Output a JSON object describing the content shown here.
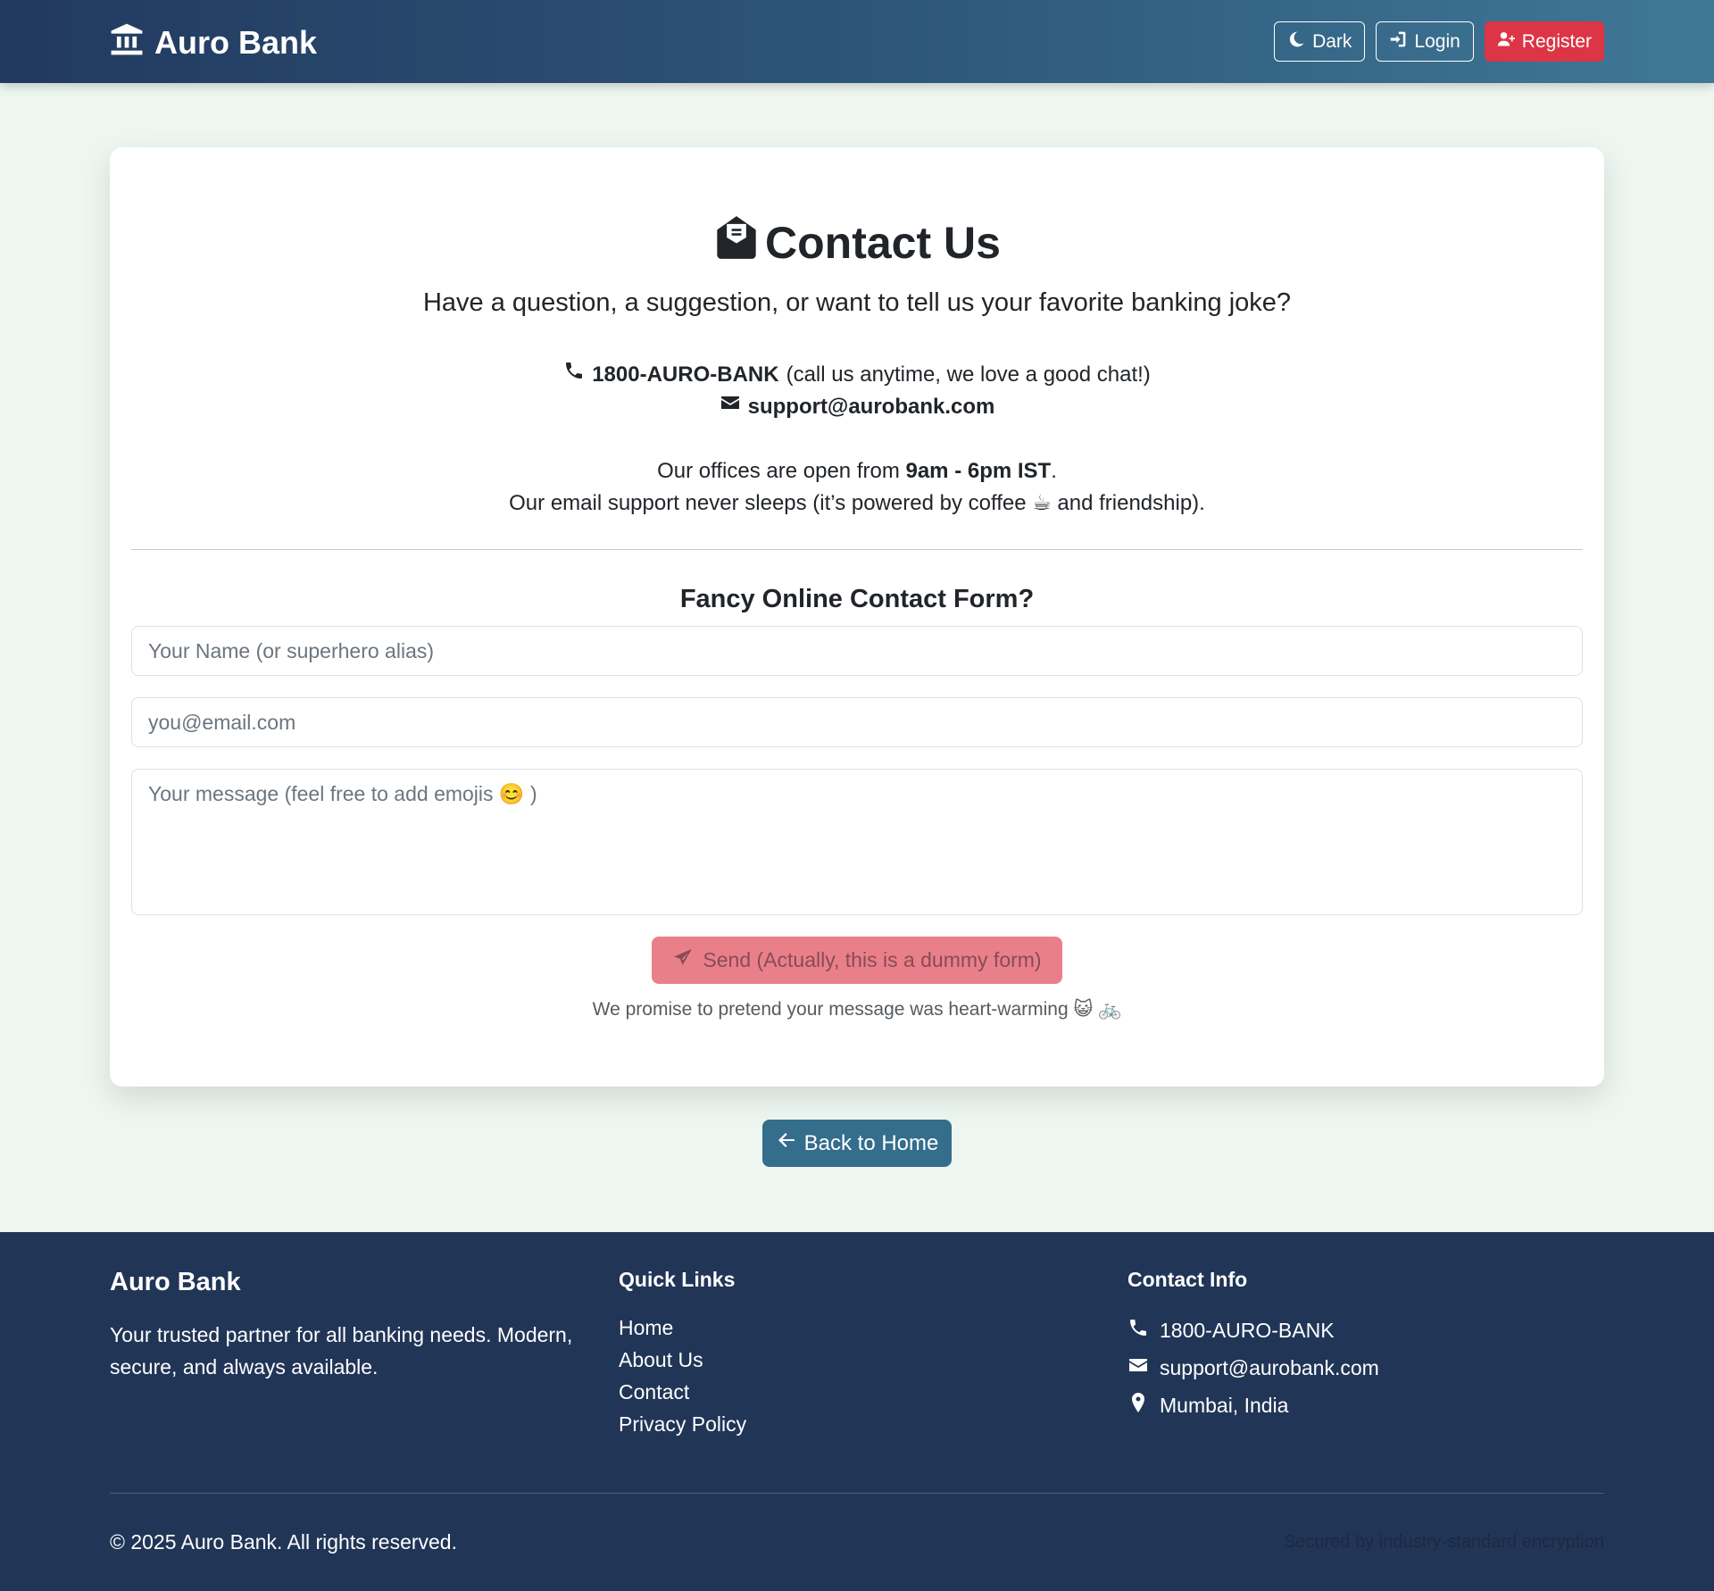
{
  "navbar": {
    "brand": "Auro Bank",
    "dark_label": "Dark",
    "login_label": "Login",
    "register_label": "Register",
    "brand_icon": "bank-icon",
    "colors": {
      "gradient_start": "#22395f",
      "gradient_end": "#3f7897",
      "register": "#dc3545"
    }
  },
  "contact": {
    "title": "Contact Us",
    "lead": "Have a question, a suggestion, or want to tell us your favorite banking joke?",
    "phone": "1800-AURO-BANK",
    "phone_note": "(call us anytime, we love a good chat!)",
    "email": "support@aurobank.com",
    "hours_prefix": "Our offices are open from",
    "hours": "9am - 6pm IST",
    "hours_suffix": ".",
    "email_support_note": "Our email support never sleeps (it’s powered by coffee ☕ and friendship)."
  },
  "form": {
    "title": "Fancy Online Contact Form?",
    "name_placeholder": "Your Name (or superhero alias)",
    "email_placeholder": "you@email.com",
    "message_placeholder": "Your message (feel free to add emojis 😊 )",
    "send_label": "Send (Actually, this is a dummy form)",
    "promise": "We promise to pretend your message was heart-warming 😺 🚲"
  },
  "back": {
    "label": "Back to Home"
  },
  "footer": {
    "brand": "Auro Bank",
    "desc": "Your trusted partner for all banking needs. Modern, secure, and always available.",
    "quick_links_title": "Quick Links",
    "links": [
      "Home",
      "About Us",
      "Contact",
      "Privacy Policy"
    ],
    "contact_title": "Contact Info",
    "phone": "1800-AURO-BANK",
    "email": "support@aurobank.com",
    "location": "Mumbai, India",
    "copyright": "© 2025 Auro Bank. All rights reserved.",
    "secured": "Secured by industry-standard encryption"
  }
}
